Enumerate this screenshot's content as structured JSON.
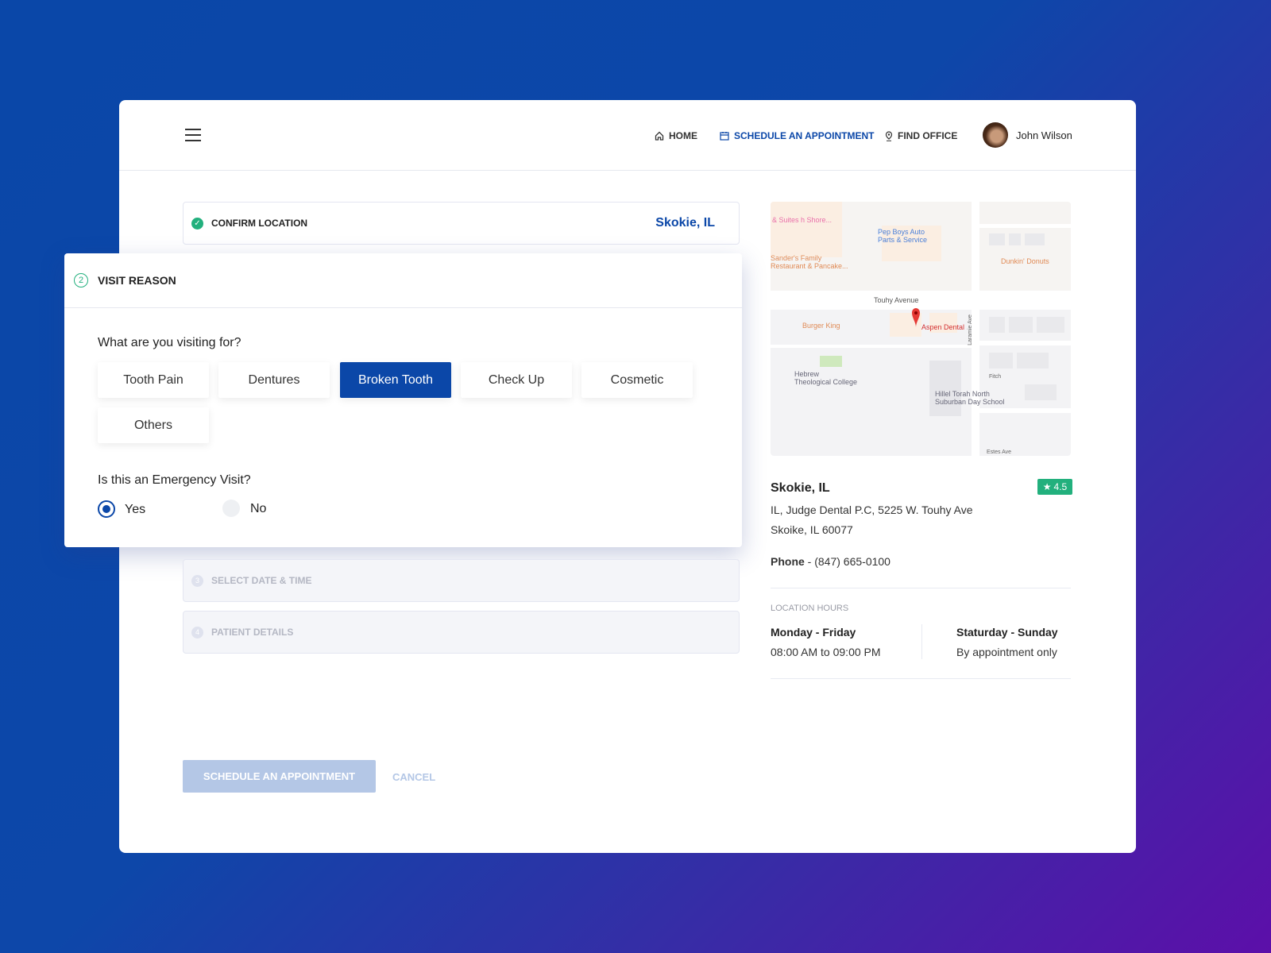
{
  "nav": {
    "home": "HOME",
    "schedule": "SCHEDULE AN APPOINTMENT",
    "find_office": "FIND OFFICE",
    "user_name": "John Wilson"
  },
  "steps": {
    "confirm": {
      "label": "CONFIRM LOCATION",
      "value": "Skokie, IL"
    },
    "visit": {
      "number": "2",
      "label": "VISIT REASON"
    },
    "date": {
      "number": "3",
      "label": "SELECT DATE & TIME"
    },
    "patient": {
      "number": "4",
      "label": "PATIENT DETAILS"
    }
  },
  "visit_reason": {
    "question": "What are you visiting for?",
    "options": [
      "Tooth Pain",
      "Dentures",
      "Broken Tooth",
      "Check Up",
      "Cosmetic",
      "Others"
    ],
    "selected": "Broken Tooth",
    "emergency_question": "Is this an Emergency Visit?",
    "yes": "Yes",
    "no": "No",
    "emergency_selected": "Yes"
  },
  "actions": {
    "submit": "SCHEDULE AN APPOINTMENT",
    "cancel": "CANCEL"
  },
  "map": {
    "labels": {
      "hotel": "& Suites\nh Shore...",
      "pepboys": "Pep Boys Auto\nParts & Service",
      "sanders": "Sander's Family\nRestaurant & Pancake...",
      "dunkin": "Dunkin' Donuts",
      "touhy": "Touhy Avenue",
      "burger": "Burger King",
      "aspen": "Aspen Dental",
      "laramie": "Laramie Ave",
      "hebrew": "Hebrew\nTheological College",
      "fitch": "Fitch",
      "hillel": "Hillel Torah North\nSuburban Day School",
      "estes": "Estes Ave"
    }
  },
  "location": {
    "name": "Skokie, IL",
    "rating": "4.5",
    "address1": "IL, Judge Dental P.C, 5225 W. Touhy Ave",
    "address2": "Skoike, IL 60077",
    "phone_label": "Phone",
    "phone": " - (847) 665-0100",
    "hours_title": "LOCATION HOURS",
    "weekday_label": "Monday - Friday",
    "weekday_hours": "08:00 AM to 09:00 PM",
    "weekend_label": "Staturday - Sunday",
    "weekend_hours": "By appointment only"
  },
  "colors": {
    "primary": "#0b47a8",
    "success": "#22b07d",
    "disabled": "#b4c7e6"
  }
}
